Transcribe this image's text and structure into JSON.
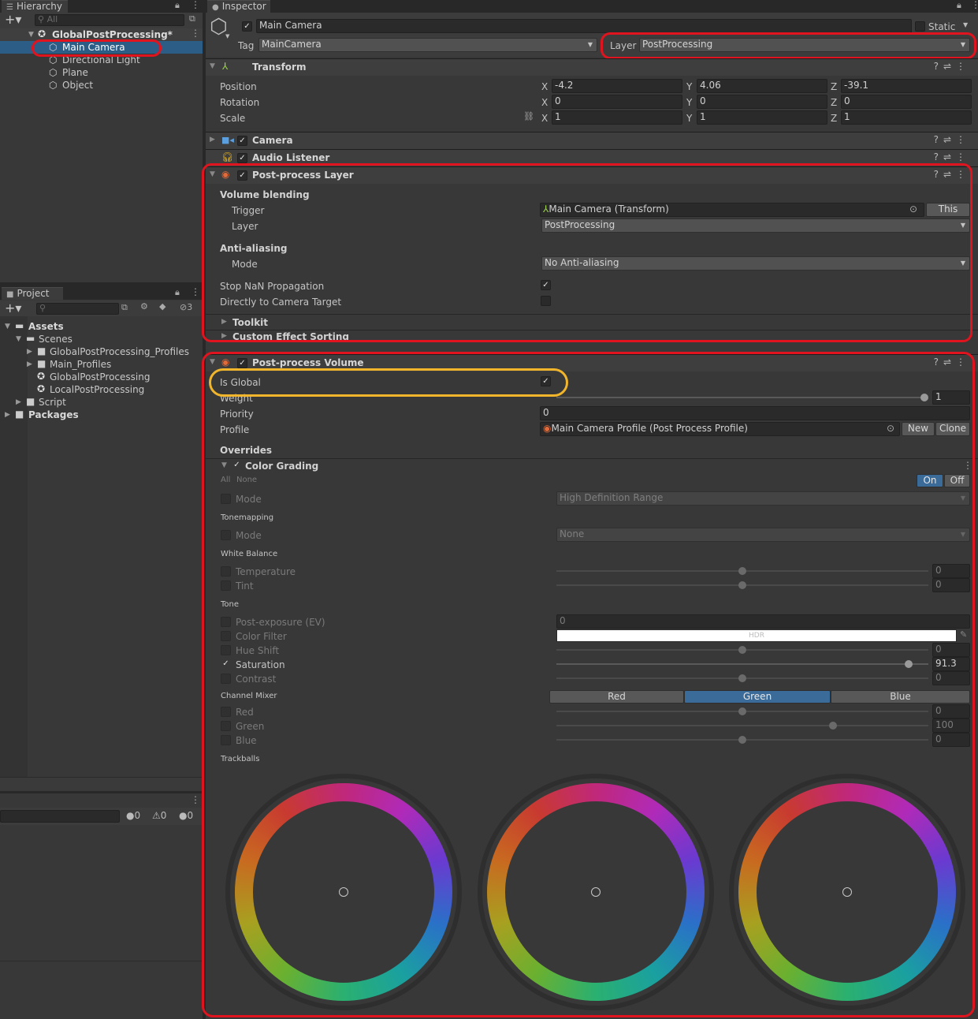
{
  "hierarchy": {
    "tab": "Hierarchy",
    "search_placeholder": "All",
    "scene": "GlobalPostProcessing*",
    "items": [
      "Main Camera",
      "Directional Light",
      "Plane",
      "Object"
    ]
  },
  "project": {
    "tab": "Project",
    "hidden_count": "3",
    "tree": [
      "Assets",
      "Scenes",
      "GlobalPostProcessing_Profiles",
      "Main_Profiles",
      "GlobalPostProcessing",
      "LocalPostProcessing",
      "Script",
      "Packages"
    ]
  },
  "console": {
    "info": "0",
    "warn": "0",
    "error": "0"
  },
  "inspector": {
    "tab": "Inspector",
    "object_name": "Main Camera",
    "static_label": "Static",
    "tag_label": "Tag",
    "tag_value": "MainCamera",
    "layer_label": "Layer",
    "layer_value": "PostProcessing",
    "transform": {
      "title": "Transform",
      "position_label": "Position",
      "rotation_label": "Rotation",
      "scale_label": "Scale",
      "axis_x": "X",
      "axis_y": "Y",
      "axis_z": "Z",
      "position": [
        "-4.2",
        "4.06",
        "-39.1"
      ],
      "rotation": [
        "0",
        "0",
        "0"
      ],
      "scale": [
        "1",
        "1",
        "1"
      ]
    },
    "camera_title": "Camera",
    "audio_title": "Audio Listener",
    "pp_layer": {
      "title": "Post-process Layer",
      "volume_blending": "Volume blending",
      "trigger_label": "Trigger",
      "trigger_value": "Main Camera (Transform)",
      "this_btn": "This",
      "layer_label": "Layer",
      "layer_value": "PostProcessing",
      "aa_heading": "Anti-aliasing",
      "mode_label": "Mode",
      "mode_value": "No Anti-aliasing",
      "stop_nan": "Stop NaN Propagation",
      "direct_target": "Directly to Camera Target",
      "toolkit": "Toolkit",
      "custom_sort": "Custom Effect Sorting"
    },
    "pp_volume": {
      "title": "Post-process Volume",
      "is_global": "Is Global",
      "weight_label": "Weight",
      "weight_value": "1",
      "priority_label": "Priority",
      "priority_value": "0",
      "profile_label": "Profile",
      "profile_value": "Main Camera Profile (Post Process Profile)",
      "new_btn": "New",
      "clone_btn": "Clone",
      "overrides": "Overrides",
      "color_grading": "Color Grading",
      "all": "All",
      "none": "None",
      "on": "On",
      "off": "Off",
      "mode_label": "Mode",
      "mode_value": "High Definition Range",
      "tonemapping": "Tonemapping",
      "tone_mode_label": "Mode",
      "tone_mode_value": "None",
      "white_balance": "White Balance",
      "temperature": "Temperature",
      "temperature_value": "0",
      "tint": "Tint",
      "tint_value": "0",
      "tone": "Tone",
      "post_exposure": "Post-exposure (EV)",
      "post_exposure_value": "0",
      "color_filter": "Color Filter",
      "hdr": "HDR",
      "hue_shift": "Hue Shift",
      "hue_shift_value": "0",
      "saturation": "Saturation",
      "saturation_value": "91.3",
      "contrast": "Contrast",
      "contrast_value": "0",
      "channel_mixer": "Channel Mixer",
      "mixer_tabs": [
        "Red",
        "Green",
        "Blue"
      ],
      "mix_red": "Red",
      "mix_red_value": "0",
      "mix_green": "Green",
      "mix_green_value": "100",
      "mix_blue": "Blue",
      "mix_blue_value": "0",
      "trackballs": "Trackballs"
    }
  },
  "colors": {
    "selection": "#2c5d87",
    "red_annotation": "#e0141e",
    "yellow_annotation": "#f0b52b",
    "toggle_on": "#3b6b99"
  }
}
